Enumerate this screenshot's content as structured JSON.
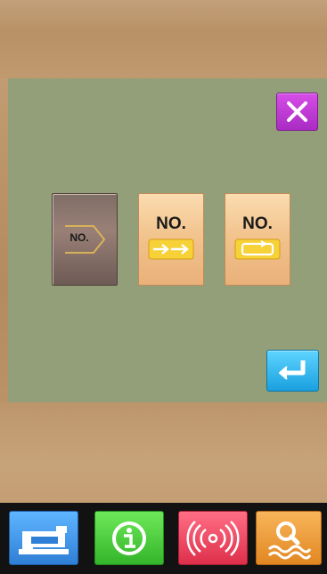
{
  "dialog": {
    "close_icon": "close-icon",
    "enter_icon": "enter-return-icon",
    "accent_close": "#c03ad8",
    "accent_enter": "#2bb0ea"
  },
  "modes": [
    {
      "label": "NO.",
      "icon": "single-arrow-icon",
      "selected": true
    },
    {
      "label": "NO.",
      "icon": "double-arrow-icon",
      "selected": false
    },
    {
      "label": "NO.",
      "icon": "loop-icon",
      "selected": false
    }
  ],
  "bottom_nav": [
    {
      "icon": "sewing-machine-icon",
      "color": "#3d8fe6"
    },
    {
      "icon": "info-icon",
      "color": "#3cc42f"
    },
    {
      "icon": "communication-icon",
      "color": "#e84660"
    },
    {
      "icon": "search-icon",
      "color": "#ea9330"
    }
  ]
}
